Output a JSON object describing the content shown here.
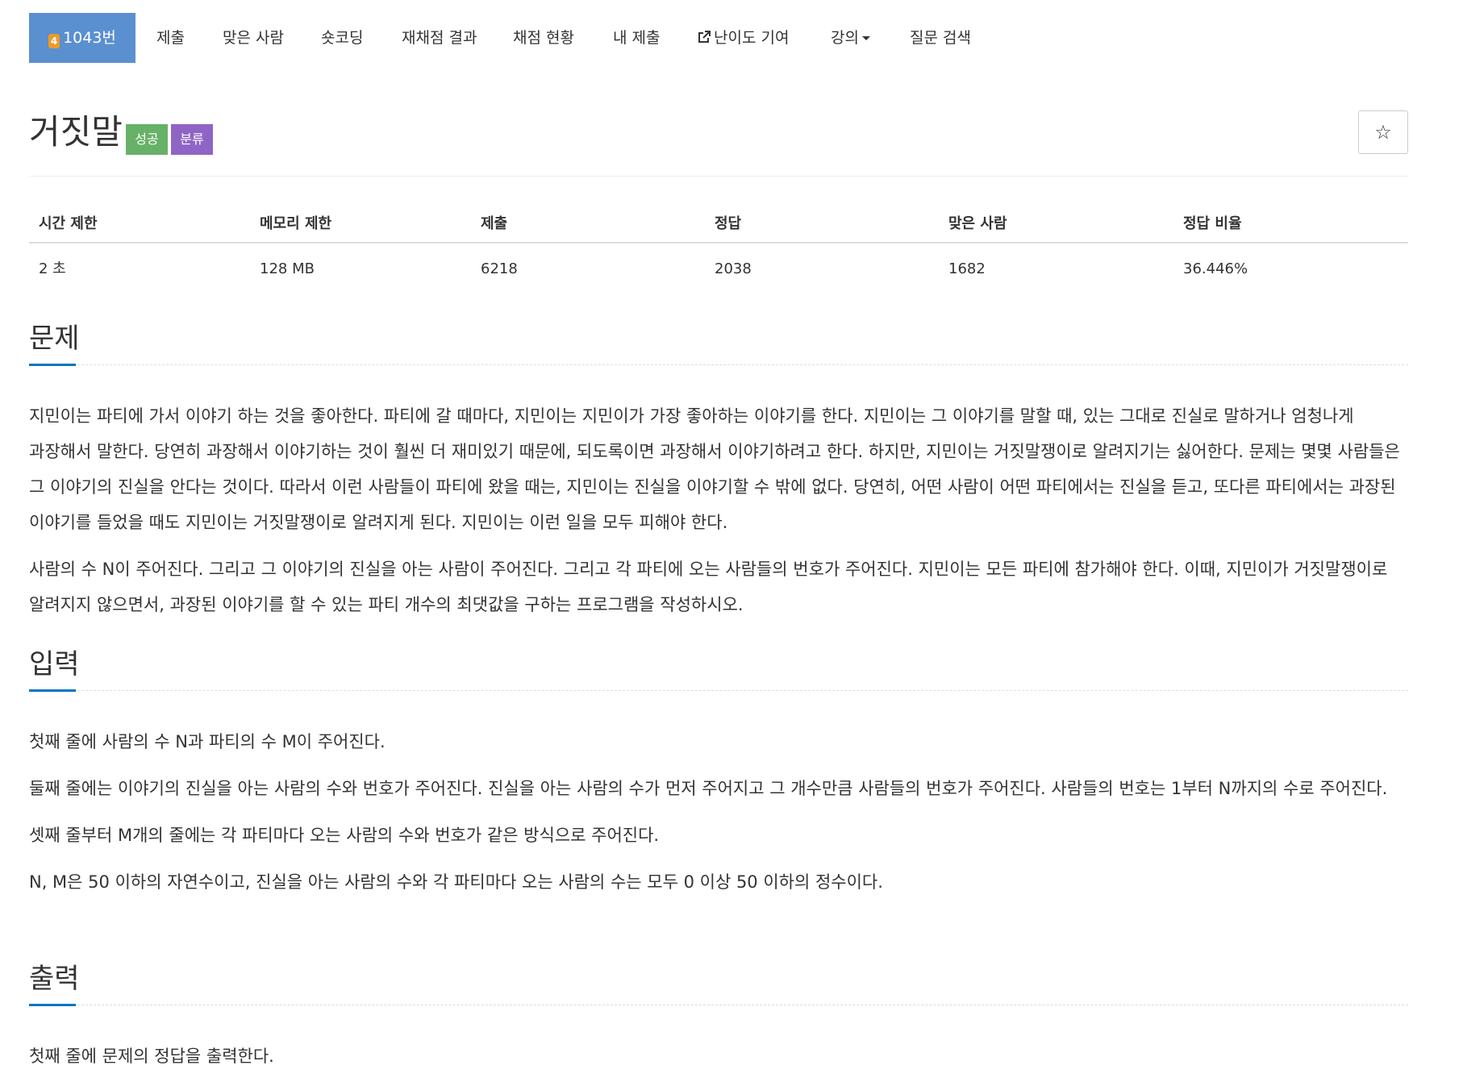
{
  "nav": {
    "active": "1043번",
    "tier_badge": "4",
    "items": [
      "제출",
      "맞은 사람",
      "숏코딩",
      "재채점 결과",
      "채점 현황",
      "내 제출",
      "난이도 기여",
      "강의",
      "질문 검색"
    ]
  },
  "problem": {
    "title": "거짓말",
    "badges": {
      "success": "성공",
      "tag": "분류"
    },
    "star": "☆"
  },
  "info": {
    "headers": [
      "시간 제한",
      "메모리 제한",
      "제출",
      "정답",
      "맞은 사람",
      "정답 비율"
    ],
    "values": [
      "2 초",
      "128 MB",
      "6218",
      "2038",
      "1682",
      "36.446%"
    ]
  },
  "sections": {
    "problem": {
      "title": "문제",
      "paragraphs": [
        "지민이는 파티에 가서 이야기 하는 것을 좋아한다. 파티에 갈 때마다, 지민이는 지민이가 가장 좋아하는 이야기를 한다. 지민이는 그 이야기를 말할 때, 있는 그대로 진실로 말하거나 엄청나게 과장해서 말한다. 당연히 과장해서 이야기하는 것이 훨씬 더 재미있기 때문에, 되도록이면 과장해서 이야기하려고 한다. 하지만, 지민이는 거짓말쟁이로 알려지기는 싫어한다. 문제는 몇몇 사람들은 그 이야기의 진실을 안다는 것이다. 따라서 이런 사람들이 파티에 왔을 때는, 지민이는 진실을 이야기할 수 밖에 없다. 당연히, 어떤 사람이 어떤 파티에서는 진실을 듣고, 또다른 파티에서는 과장된 이야기를 들었을 때도 지민이는 거짓말쟁이로 알려지게 된다. 지민이는 이런 일을 모두 피해야 한다.",
        "사람의 수 N이 주어진다. 그리고 그 이야기의 진실을 아는 사람이 주어진다. 그리고 각 파티에 오는 사람들의 번호가 주어진다. 지민이는 모든 파티에 참가해야 한다. 이때, 지민이가 거짓말쟁이로 알려지지 않으면서, 과장된 이야기를 할 수 있는 파티 개수의 최댓값을 구하는 프로그램을 작성하시오."
      ]
    },
    "input": {
      "title": "입력",
      "paragraphs": [
        "첫째 줄에 사람의 수 N과 파티의 수 M이 주어진다.",
        "둘째 줄에는 이야기의 진실을 아는 사람의 수와 번호가 주어진다. 진실을 아는 사람의 수가 먼저 주어지고 그 개수만큼 사람들의 번호가 주어진다. 사람들의 번호는 1부터 N까지의 수로 주어진다.",
        "셋째 줄부터 M개의 줄에는 각 파티마다 오는 사람의 수와 번호가 같은 방식으로 주어진다.",
        "N, M은 50 이하의 자연수이고, 진실을 아는 사람의 수와 각 파티마다 오는 사람의 수는 모두 0 이상 50 이하의 정수이다."
      ]
    },
    "output": {
      "title": "출력",
      "paragraphs": [
        "첫째 줄에 문제의 정답을 출력한다."
      ]
    }
  },
  "colors": {
    "nav_active": "#5a8fd0",
    "tier_badge": "#ec9a29",
    "success": "#67b168",
    "tag": "#8e65c6",
    "section_underline": "#0076c0"
  }
}
